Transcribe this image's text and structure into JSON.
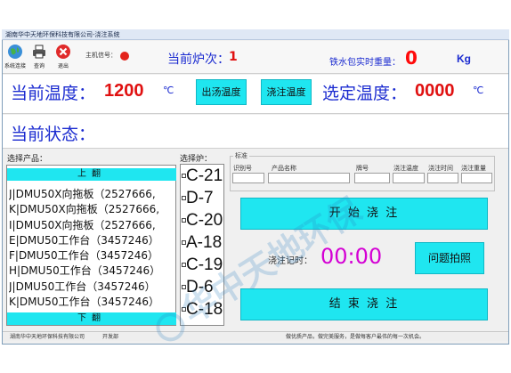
{
  "window": {
    "title": "湖南华中天地环保科技有限公司-浇注系统"
  },
  "toolbar": {
    "items": [
      {
        "label": "系统连接",
        "icon": "globe-icon"
      },
      {
        "label": "查询",
        "icon": "printer-icon"
      },
      {
        "label": "退出",
        "icon": "exit-icon"
      }
    ]
  },
  "header": {
    "machine_label": "主机信号：",
    "furnace_label": "当前炉次：",
    "furnace_value": "1",
    "weight_label": "铁水包实时重量：",
    "weight_value": "0",
    "weight_unit": "Kg"
  },
  "temperature": {
    "current_label": "当前温度：",
    "current_value": "1200",
    "current_unit": "℃",
    "tap_button": "出汤温度",
    "pour_button": "浇注温度",
    "set_label": "选定温度：",
    "set_value": "0000",
    "set_unit": "℃"
  },
  "state": {
    "label": "当前状态："
  },
  "products": {
    "section_label": "选择产品：",
    "page_up": "上翻",
    "page_down": "下翻",
    "items": [
      "J|DMU50X向拖板（2527666,",
      "K|DMU50X向拖板（2527666,",
      "I|DMU50X向拖板（2527666,",
      "E|DMU50工作台（3457246）",
      "F|DMU50工作台（3457246）",
      "H|DMU50工作台（3457246）",
      "J|DMU50工作台（3457246）",
      "K|DMU50工作台（3457246）"
    ]
  },
  "furnaces": {
    "section_label": "选择炉：",
    "items": [
      "C-21",
      "D-7",
      "C-20",
      "A-18",
      "C-19",
      "D-6",
      "C-18"
    ]
  },
  "standard": {
    "legend": "标准",
    "columns": [
      "识别号",
      "产品名称",
      "牌号",
      "浇注温度",
      "浇注时间",
      "浇注重量"
    ]
  },
  "actions": {
    "start_pour": "开 始 浇 注",
    "timer_label": "浇注记时：",
    "timer_value": "00:00",
    "photo_button": "问题拍照",
    "end_pour": "结 束 浇 注"
  },
  "statusbar": {
    "company": "湖南华中天地环保科技有限公司",
    "developer": "开发部",
    "slogan": "做优质产品，做完美服务，是做每客户最伟的每一次机会。"
  },
  "watermark": {
    "text": "华中天地环保"
  },
  "colors": {
    "accent_cyan": "#1fe6f0",
    "label_blue": "#1b2bd0",
    "value_red": "#e01010",
    "timer_magenta": "#d400d4"
  }
}
